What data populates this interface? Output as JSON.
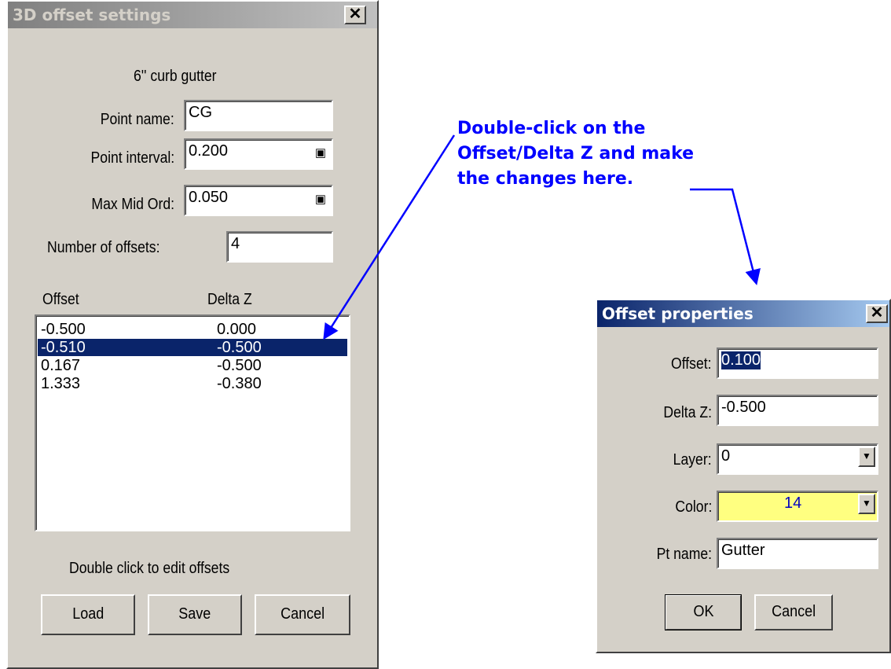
{
  "settings_dialog": {
    "title": "3D offset settings",
    "close_label": "✕",
    "description": "6'' curb  gutter",
    "point_name_label": "Point name:",
    "point_name_value": "CG",
    "point_interval_label": "Point interval:",
    "point_interval_value": "0.200",
    "max_mid_ord_label": "Max Mid Ord:",
    "max_mid_ord_value": "0.050",
    "number_of_offsets_label": "Number of offsets:",
    "number_of_offsets_value": "4",
    "columns": [
      "Offset",
      "Delta Z"
    ],
    "rows": [
      {
        "offset": "-0.500",
        "delta_z": "0.000",
        "selected": false
      },
      {
        "offset": "-0.510",
        "delta_z": "-0.500",
        "selected": true
      },
      {
        "offset": "0.167",
        "delta_z": "-0.500",
        "selected": false
      },
      {
        "offset": "1.333",
        "delta_z": "-0.380",
        "selected": false
      }
    ],
    "hint": "Double click to edit offsets",
    "load_label": "Load",
    "save_label": "Save",
    "cancel_label": "Cancel"
  },
  "annotation": {
    "lines": [
      "Double-click on the",
      "Offset/Delta Z and make",
      "the changes here."
    ],
    "color": "#0000ff"
  },
  "offset_dialog": {
    "title": "Offset properties",
    "close_label": "✕",
    "offset_label": "Offset:",
    "offset_value": "0.100",
    "delta_z_label": "Delta Z:",
    "delta_z_value": "-0.500",
    "layer_label": "Layer:",
    "layer_value": "0",
    "color_label": "Color:",
    "color_value": "14",
    "color_swatch": "#ffff80",
    "pt_name_label": "Pt name:",
    "pt_name_value": "Gutter",
    "ok_label": "OK",
    "cancel_label": "Cancel"
  },
  "icons": {
    "picker": "pick-from-drawing-icon",
    "spin": "dropdown-arrow-icon"
  }
}
